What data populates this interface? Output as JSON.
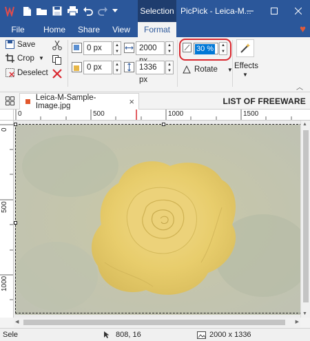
{
  "titlebar": {
    "context_tab": "Selection",
    "window_title": "PicPick - Leica-M..."
  },
  "tabs": [
    {
      "label": "File"
    },
    {
      "label": "Home"
    },
    {
      "label": "Share"
    },
    {
      "label": "View"
    },
    {
      "label": "Format"
    }
  ],
  "ribbon": {
    "save": "Save",
    "crop": "Crop",
    "deselect": "Deselect",
    "x_value": "0 px",
    "width_value": "2000 px",
    "y_value": "0 px",
    "height_value": "1336 px",
    "zoom_value": "30 %",
    "rotate": "Rotate",
    "effects": "Effects"
  },
  "document": {
    "tab_title": "Leica-M-Sample-Image.jpg",
    "watermark": "LIST OF FREEWARE"
  },
  "ruler": {
    "h_labels": [
      "0",
      "500",
      "1000",
      "1500"
    ],
    "v_labels": [
      "0",
      "500",
      "1000"
    ]
  },
  "status": {
    "left": "Sele",
    "cursor": "808, 16",
    "image_size": "2000 x 1336"
  },
  "colors": {
    "accent": "#2b579a",
    "selection_highlight": "#0078d7",
    "callout": "#d9272e"
  }
}
